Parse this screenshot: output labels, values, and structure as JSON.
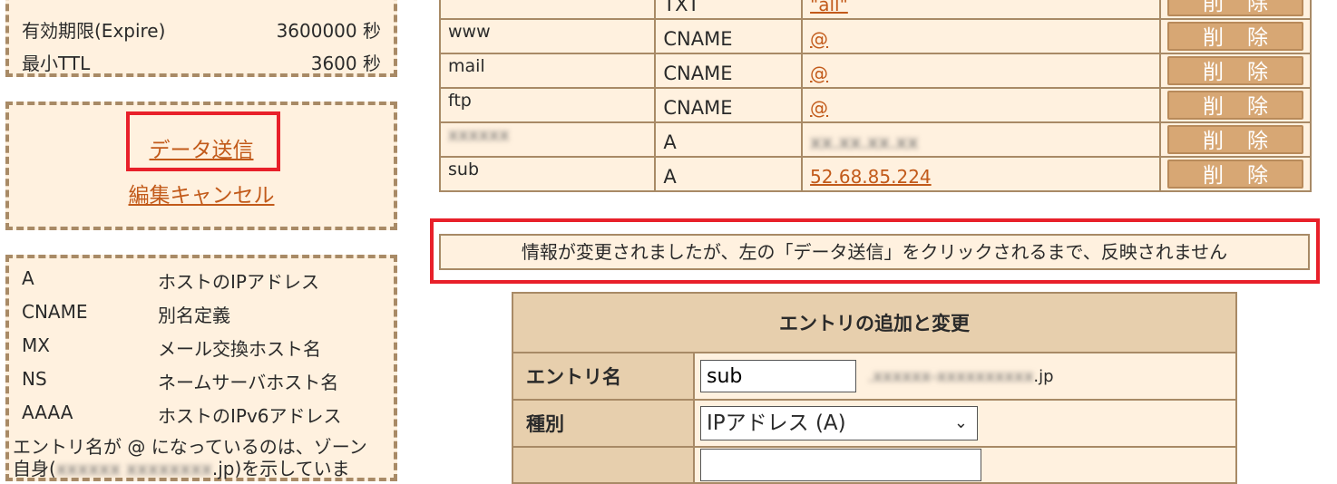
{
  "soa": {
    "rows": [
      {
        "label": "有効期限(Expire)",
        "value": "3600000 秒"
      },
      {
        "label": "最小TTL",
        "value": "3600 秒"
      }
    ]
  },
  "actions": {
    "send_label": "データ送信",
    "cancel_label": "編集キャンセル"
  },
  "legend": {
    "items": [
      {
        "type": "A",
        "desc": "ホストのIPアドレス"
      },
      {
        "type": "CNAME",
        "desc": "別名定義"
      },
      {
        "type": "MX",
        "desc": "メール交換ホスト名"
      },
      {
        "type": "NS",
        "desc": "ネームサーバホスト名"
      },
      {
        "type": "AAAA",
        "desc": "ホストのIPv6アドレス"
      }
    ],
    "note_line1": "エントリ名が @ になっているのは、ゾーン",
    "note_line2_start": "自身(",
    "note_line2_end": ".jp)を示していま"
  },
  "records": {
    "delete_label": "削除",
    "rows": [
      {
        "host": "",
        "type": "TXT",
        "value": "\"all\"",
        "value_link": true
      },
      {
        "host": "www",
        "type": "CNAME",
        "value": "@",
        "value_link": true
      },
      {
        "host": "mail",
        "type": "CNAME",
        "value": "@",
        "value_link": true
      },
      {
        "host": "ftp",
        "type": "CNAME",
        "value": "@",
        "value_link": true
      },
      {
        "host": "",
        "type": "A",
        "value": "",
        "value_link": true,
        "blurred": true
      },
      {
        "host": "sub",
        "type": "A",
        "value": "52.68.85.224",
        "value_link": true
      }
    ]
  },
  "notice": {
    "message": "情報が変更されましたが、左の「データ送信」をクリックされるまで、反映されません"
  },
  "entry_form": {
    "title": "エントリの追加と変更",
    "entry_name_label": "エントリ名",
    "entry_name_value": "sub",
    "domain_suffix_end": ".jp",
    "type_label": "種別",
    "type_selected": "IPアドレス (A)"
  },
  "colors": {
    "panel_bg": "#fff1df",
    "header_bg": "#e7cfad",
    "border": "#a88a66",
    "button": "#d7a774",
    "link": "#c25a1a",
    "highlight": "#e8202a"
  }
}
